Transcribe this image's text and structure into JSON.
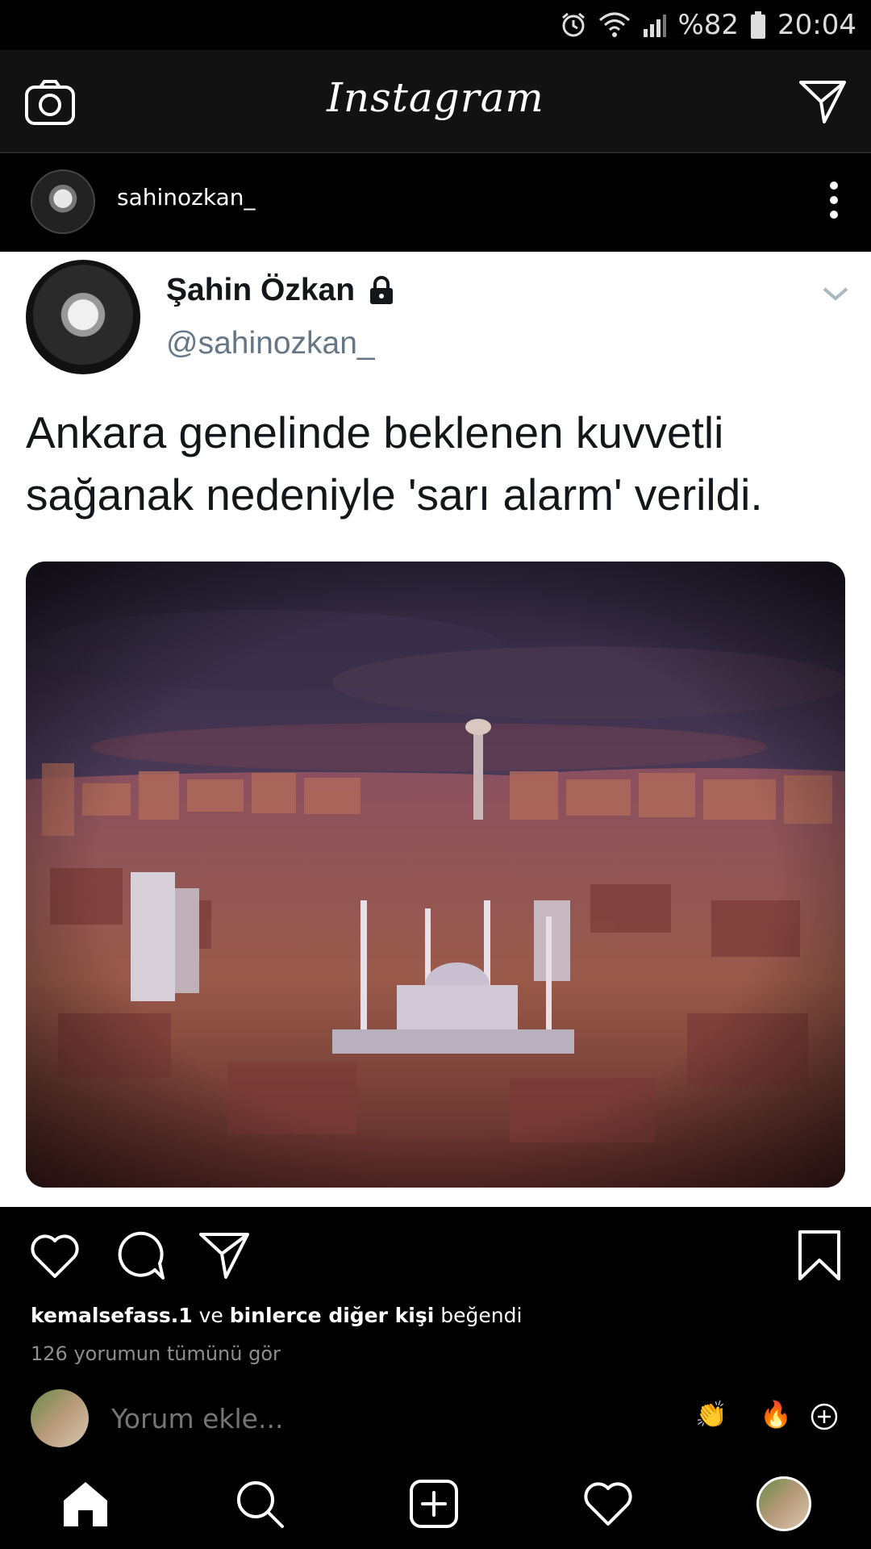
{
  "status_bar": {
    "battery": "%82",
    "time": "20:04"
  },
  "header": {
    "app_title": "Instagram"
  },
  "post": {
    "username": "sahinozkan_",
    "tweet": {
      "name": "Şahin Özkan",
      "handle": "@sahinozkan_",
      "text": "Ankara genelinde beklenen kuvvetli sağanak nedeniyle 'sarı alarm' verildi."
    },
    "likes": {
      "first_user": "kemalsefass.1",
      "connector": " ve ",
      "others": "binlerce diğer kişi",
      "suffix": " beğendi"
    },
    "view_comments": "126 yorumun tümünü gör",
    "comment_placeholder": "Yorum ekle...",
    "quick_emojis": [
      "👏",
      "🔥"
    ]
  },
  "colors": {
    "twitter_handle": "#657786",
    "instagram_dark": "#121212"
  }
}
